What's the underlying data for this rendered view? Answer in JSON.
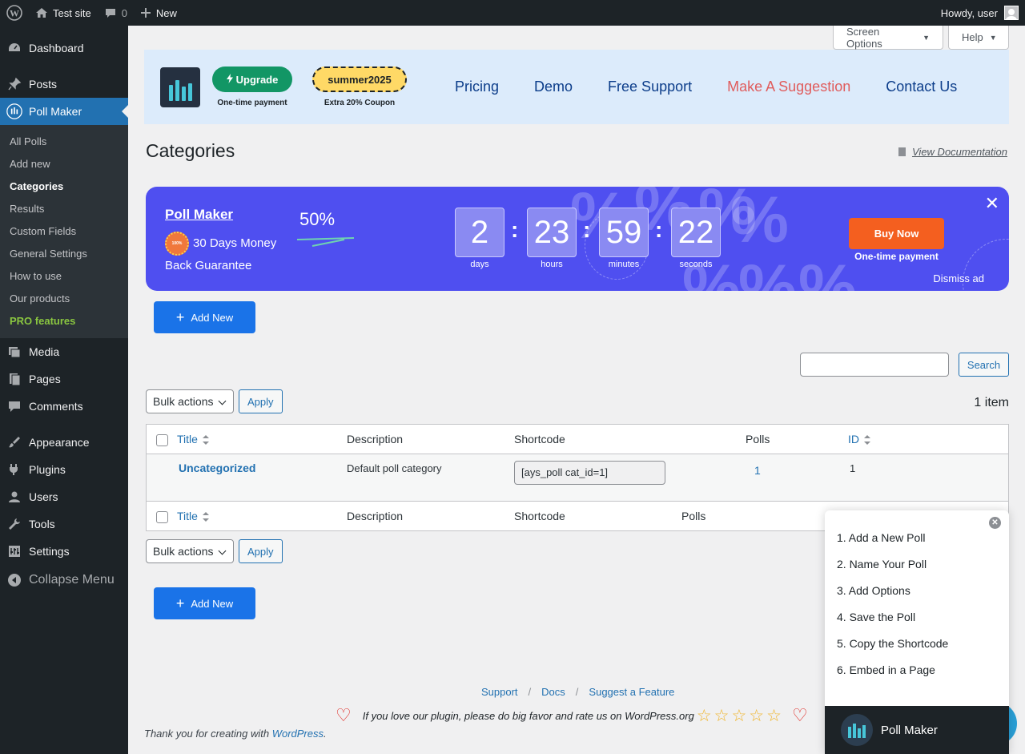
{
  "adminbar": {
    "site_name": "Test site",
    "comments_count": "0",
    "new_label": "New",
    "howdy": "Howdy, user"
  },
  "sidebar": {
    "items": [
      {
        "label": "Dashboard",
        "icon": "dashboard-icon"
      },
      {
        "label": "Posts",
        "icon": "pin-icon"
      },
      {
        "label": "Poll Maker",
        "icon": "poll-icon",
        "active": true
      },
      {
        "label": "Media",
        "icon": "media-icon"
      },
      {
        "label": "Pages",
        "icon": "pages-icon"
      },
      {
        "label": "Comments",
        "icon": "comment-icon"
      },
      {
        "label": "Appearance",
        "icon": "brush-icon"
      },
      {
        "label": "Plugins",
        "icon": "plug-icon"
      },
      {
        "label": "Users",
        "icon": "user-icon"
      },
      {
        "label": "Tools",
        "icon": "wrench-icon"
      },
      {
        "label": "Settings",
        "icon": "settings-icon"
      }
    ],
    "submenu": [
      "All Polls",
      "Add new",
      "Categories",
      "Results",
      "Custom Fields",
      "General Settings",
      "How to use",
      "Our products",
      "PRO features"
    ],
    "collapse": "Collapse Menu"
  },
  "screen_options": "Screen Options",
  "help": "Help",
  "topbanner": {
    "upgrade": "Upgrade",
    "upgrade_sub": "One-time payment",
    "coupon": "summer2025",
    "coupon_sub": "Extra 20% Coupon",
    "links": [
      "Pricing",
      "Demo",
      "Free Support",
      "Make A Suggestion",
      "Contact Us"
    ]
  },
  "page_title": "Categories",
  "view_doc": "View Documentation",
  "promo": {
    "title": "Poll Maker",
    "guarantee": "30 Days Money Back Guarantee",
    "seal_text": "100%",
    "discount": "50%",
    "countdown": [
      {
        "value": "2",
        "label": "days"
      },
      {
        "value": "23",
        "label": "hours"
      },
      {
        "value": "59",
        "label": "minutes"
      },
      {
        "value": "22",
        "label": "seconds"
      }
    ],
    "buy": "Buy Now",
    "buy_sub": "One-time payment",
    "dismiss": "Dismiss ad",
    "accent": "#4f4ff0"
  },
  "add_new": "Add New",
  "search_btn": "Search",
  "bulk_actions": "Bulk actions",
  "apply": "Apply",
  "items_count": "1 item",
  "table": {
    "columns": [
      "Title",
      "Description",
      "Shortcode",
      "Polls",
      "ID"
    ],
    "rows": [
      {
        "title": "Uncategorized",
        "description": "Default poll category",
        "shortcode": "[ays_poll cat_id=1]",
        "polls": "1",
        "id": "1"
      }
    ]
  },
  "footer": {
    "links": [
      "Support",
      "Docs",
      "Suggest a Feature"
    ],
    "rate_text": "If you love our plugin, please do big favor and rate us on WordPress.org",
    "thanks_prefix": "Thank you for creating with ",
    "wordpress": "WordPress",
    "thanks_suffix": "."
  },
  "helper": {
    "steps": [
      "1. Add a New Poll",
      "2. Name Your Poll",
      "3. Add Options",
      "4. Save the Poll",
      "5. Copy the Shortcode",
      "6. Embed in a Page"
    ],
    "title": "Poll Maker"
  }
}
